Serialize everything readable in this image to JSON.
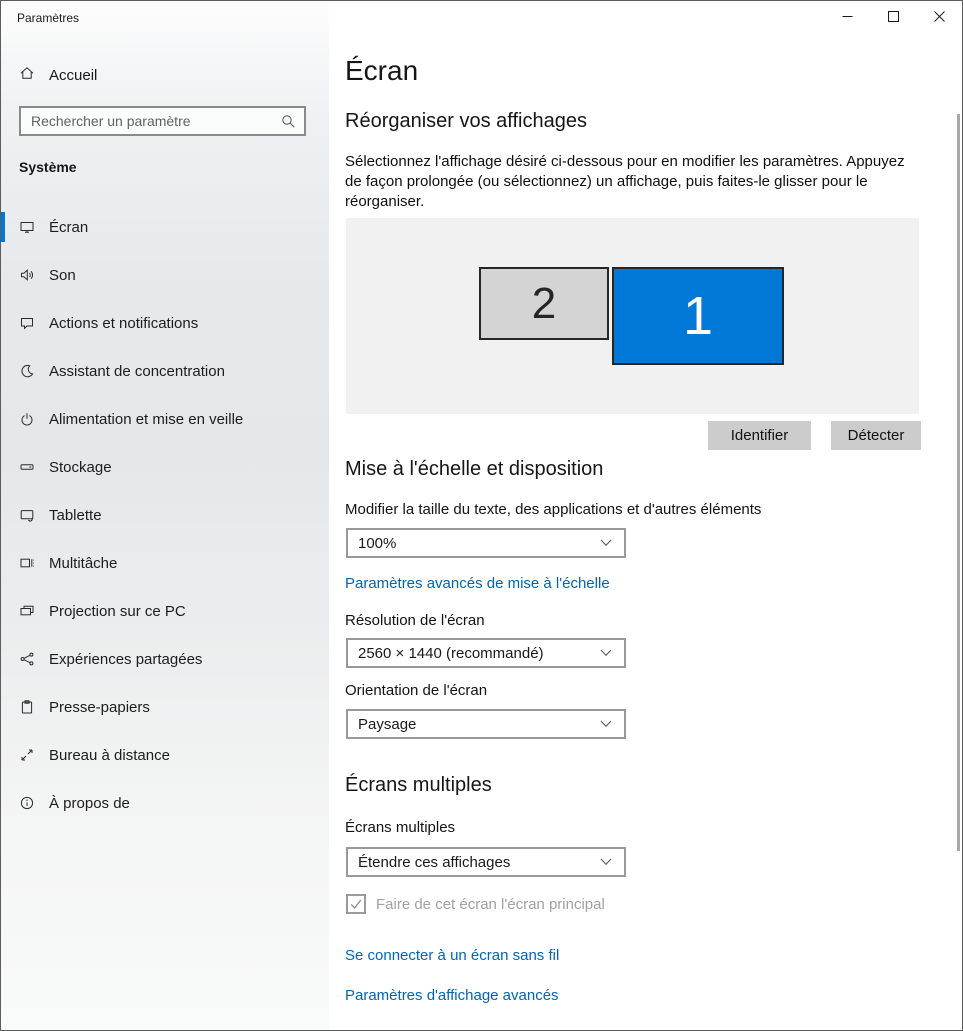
{
  "window": {
    "title": "Paramètres",
    "controls": {
      "minimize": "minimize",
      "maximize": "maximize",
      "close": "close"
    }
  },
  "sidebar": {
    "home_label": "Accueil",
    "search_placeholder": "Rechercher un paramètre",
    "section_header": "Système",
    "items": [
      {
        "label": "Écran",
        "icon": "display-icon",
        "selected": true
      },
      {
        "label": "Son",
        "icon": "speaker-icon",
        "selected": false
      },
      {
        "label": "Actions et notifications",
        "icon": "notifications-icon",
        "selected": false
      },
      {
        "label": "Assistant de concentration",
        "icon": "moon-icon",
        "selected": false
      },
      {
        "label": "Alimentation et mise en veille",
        "icon": "power-icon",
        "selected": false
      },
      {
        "label": "Stockage",
        "icon": "storage-icon",
        "selected": false
      },
      {
        "label": "Tablette",
        "icon": "tablet-icon",
        "selected": false
      },
      {
        "label": "Multitâche",
        "icon": "multitask-icon",
        "selected": false
      },
      {
        "label": "Projection sur ce PC",
        "icon": "project-icon",
        "selected": false
      },
      {
        "label": "Expériences partagées",
        "icon": "shared-icon",
        "selected": false
      },
      {
        "label": "Presse-papiers",
        "icon": "clipboard-icon",
        "selected": false
      },
      {
        "label": "Bureau à distance",
        "icon": "remote-desktop-icon",
        "selected": false
      },
      {
        "label": "À propos de",
        "icon": "info-icon",
        "selected": false
      }
    ]
  },
  "main": {
    "page_title": "Écran",
    "rearrange": {
      "heading": "Réorganiser vos affichages",
      "description": "Sélectionnez l'affichage désiré ci-dessous pour en modifier les paramètres. Appuyez de façon prolongée (ou sélectionnez) un affichage, puis faites-le glisser pour le réorganiser.",
      "monitors": [
        {
          "id": "2"
        },
        {
          "id": "1"
        }
      ],
      "identify_button": "Identifier",
      "detect_button": "Détecter"
    },
    "scaling": {
      "heading": "Mise à l'échelle et disposition",
      "scale_label": "Modifier la taille du texte, des applications et d'autres éléments",
      "scale_value": "100%",
      "advanced_scaling_link": "Paramètres avancés de mise à l'échelle",
      "resolution_label": "Résolution de l'écran",
      "resolution_value": "2560 × 1440 (recommandé)",
      "orientation_label": "Orientation de l'écran",
      "orientation_value": "Paysage"
    },
    "multiple_displays": {
      "heading": "Écrans multiples",
      "label": "Écrans multiples",
      "value": "Étendre ces affichages",
      "primary_checkbox_label": "Faire de cet écran l'écran principal",
      "primary_checkbox_checked": true,
      "primary_checkbox_disabled": true
    },
    "links": {
      "wireless": "Se connecter à un écran sans fil",
      "advanced_display": "Paramètres d'affichage avancés"
    }
  },
  "colors": {
    "accent": "#0078d7",
    "link": "#0066b4",
    "panel_bg": "#f1f1f1",
    "monitor_secondary": "#d4d4d4",
    "button_bg": "#cccccc"
  }
}
